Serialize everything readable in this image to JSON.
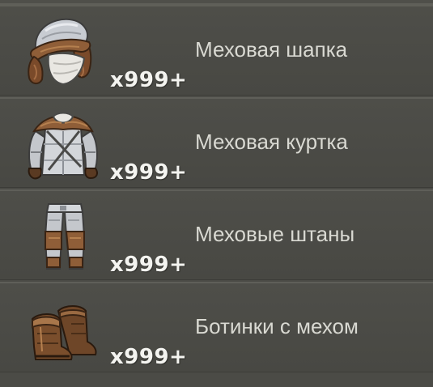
{
  "colors": {
    "background": "#4b4b46",
    "row_border": "#5f5f59",
    "quantity_text": "#f4f4f0",
    "name_text": "#d9d9d2",
    "fur_brown": "#8a5a35",
    "leather_dark": "#5a3a22",
    "fabric_light": "#c9ccd0"
  },
  "items": [
    {
      "name": "Меховая шапка",
      "quantity": "x999+",
      "icon": "fur-hat-icon"
    },
    {
      "name": "Меховая куртка",
      "quantity": "x999+",
      "icon": "fur-jacket-icon"
    },
    {
      "name": "Меховые штаны",
      "quantity": "x999+",
      "icon": "fur-pants-icon"
    },
    {
      "name": "Ботинки с мехом",
      "quantity": "x999+",
      "icon": "fur-boots-icon"
    }
  ]
}
